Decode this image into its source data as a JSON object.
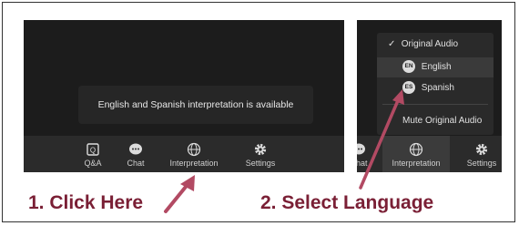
{
  "left_panel": {
    "toast": "English and Spanish interpretation is available",
    "toolbar": [
      {
        "label": "Q&A",
        "icon": "qa-icon"
      },
      {
        "label": "Chat",
        "icon": "chat-icon"
      },
      {
        "label": "Interpretation",
        "icon": "globe-icon"
      },
      {
        "label": "Settings",
        "icon": "gear-icon"
      }
    ]
  },
  "right_panel": {
    "menu": {
      "original_audio": "Original Audio",
      "english_badge": "EN",
      "english": "English",
      "spanish_badge": "ES",
      "spanish": "Spanish",
      "mute_original": "Mute Original Audio"
    },
    "toolbar": [
      {
        "label": "Chat",
        "icon": "chat-icon"
      },
      {
        "label": "Interpretation",
        "icon": "globe-icon"
      },
      {
        "label": "Settings",
        "icon": "gear-icon"
      }
    ]
  },
  "captions": {
    "step1": "1. Click Here",
    "step2": "2. Select Language"
  },
  "colors": {
    "caption": "#7a1f35",
    "arrow": "#b24a63",
    "panel": "#1c1c1c"
  }
}
